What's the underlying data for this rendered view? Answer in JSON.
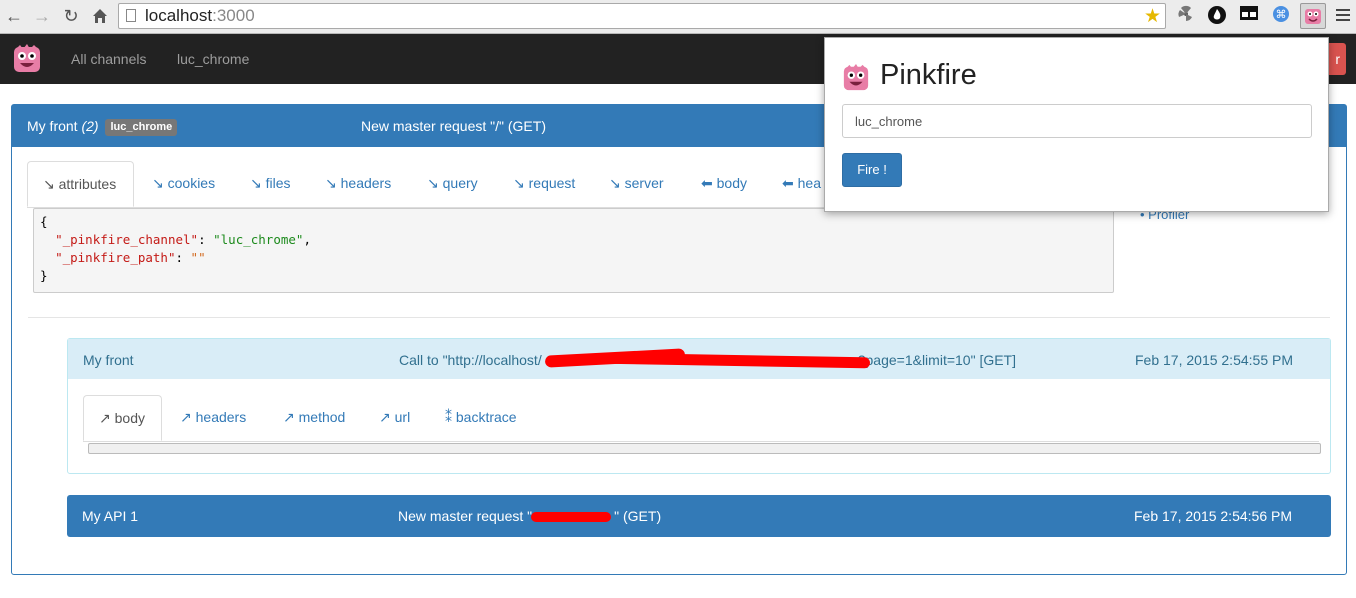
{
  "browser": {
    "url_host": "localhost",
    "url_port": ":3000"
  },
  "navbar": {
    "links": [
      "All channels",
      "luc_chrome"
    ],
    "right_button_text": "r"
  },
  "master": {
    "title": "My front",
    "count": "(2)",
    "channel_badge": "luc_chrome",
    "request_text": "New master request \"/\" (GET)",
    "tabs": [
      "↘ attributes",
      "↘ cookies",
      "↘ files",
      "↘ headers",
      "↘ query",
      "↘ request",
      "↘ server",
      "⬅ body",
      "⬅ hea"
    ],
    "code": {
      "open": "{",
      "key1": "\"_pinkfire_channel\"",
      "val1": "\"luc_chrome\"",
      "key2": "\"_pinkfire_path\"",
      "val2": "\"\"",
      "close": "}"
    },
    "side_link": "Profiler"
  },
  "sub_request": {
    "title": "My front",
    "call_prefix": "Call to \"http://localhost/",
    "call_suffix": "?page=1&limit=10\" [GET]",
    "timestamp": "Feb 17, 2015 2:54:55 PM",
    "tabs": [
      "↗ body",
      "↗ headers",
      "↗ method",
      "↗ url",
      "⁑ backtrace"
    ]
  },
  "api_request": {
    "title": "My API 1",
    "request_prefix": "New master request \"",
    "request_suffix": "\" (GET)",
    "timestamp": "Feb 17, 2015 2:54:56 PM"
  },
  "popup": {
    "title": "Pinkfire",
    "input_value": "luc_chrome",
    "button_label": "Fire !"
  },
  "colors": {
    "primary": "#337ab7",
    "info_bg": "#d9edf7",
    "navbar_bg": "#222222",
    "redaction": "#ff0000"
  }
}
